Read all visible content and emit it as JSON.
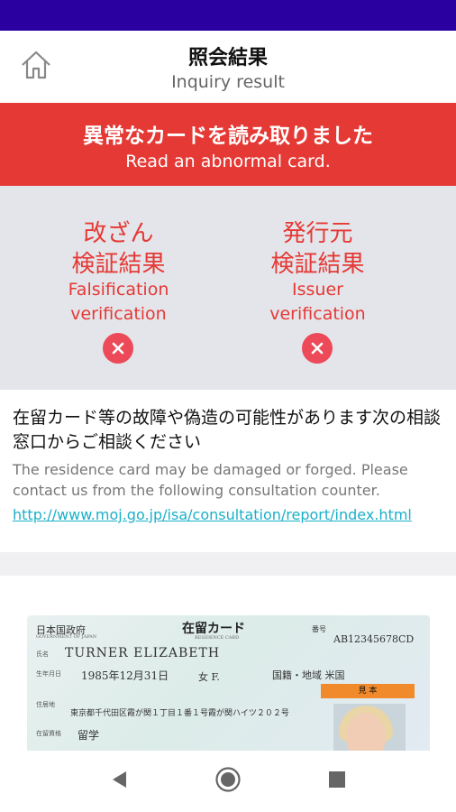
{
  "header": {
    "title_ja": "照会結果",
    "title_en": "Inquiry result",
    "home_icon": "home-icon"
  },
  "alert": {
    "title_ja": "異常なカードを読み取りました",
    "title_en": "Read an abnormal card."
  },
  "verification": {
    "falsification": {
      "ja_line1": "改ざん",
      "ja_line2": "検証結果",
      "en_line1": "Falsification",
      "en_line2": "verification",
      "result_icon": "error-x-icon"
    },
    "issuer": {
      "ja_line1": "発行元",
      "ja_line2": "検証結果",
      "en_line1": "Issuer",
      "en_line2": "verification",
      "result_icon": "error-x-icon"
    }
  },
  "message": {
    "ja": "在留カード等の故障や偽造の可能性があります次の相談窓口からご相談ください",
    "en": "The residence card may be damaged or forged. Please contact us from the following consultation counter.",
    "link": "http://www.moj.go.jp/isa/consultation/report/index.html"
  },
  "card": {
    "gov_ja": "日本国政府",
    "gov_en": "GOVERNMENT OF JAPAN",
    "title_ja": "在留カード",
    "title_en": "RESIDENCE CARD",
    "number_label": "番号",
    "number": "AB12345678CD",
    "name_label": "氏名",
    "name": "TURNER  ELIZABETH",
    "dob_label": "生年月日",
    "dob": "1985年12月31日",
    "sex": "女 F.",
    "nationality": "国籍・地域 米国",
    "address_label": "住居地",
    "address": "東京都千代田区霞が関１丁目１番１号霞が関ハイツ２０２号",
    "status_label": "在留資格",
    "status": "留学",
    "stamp": "見 本"
  },
  "colors": {
    "status_bar": "#2a00a0",
    "alert": "#e53935",
    "link": "#1ab0c8"
  },
  "nav": {
    "back_icon": "back-triangle-icon",
    "home_icon": "home-circle-icon",
    "recents_icon": "recents-square-icon"
  }
}
